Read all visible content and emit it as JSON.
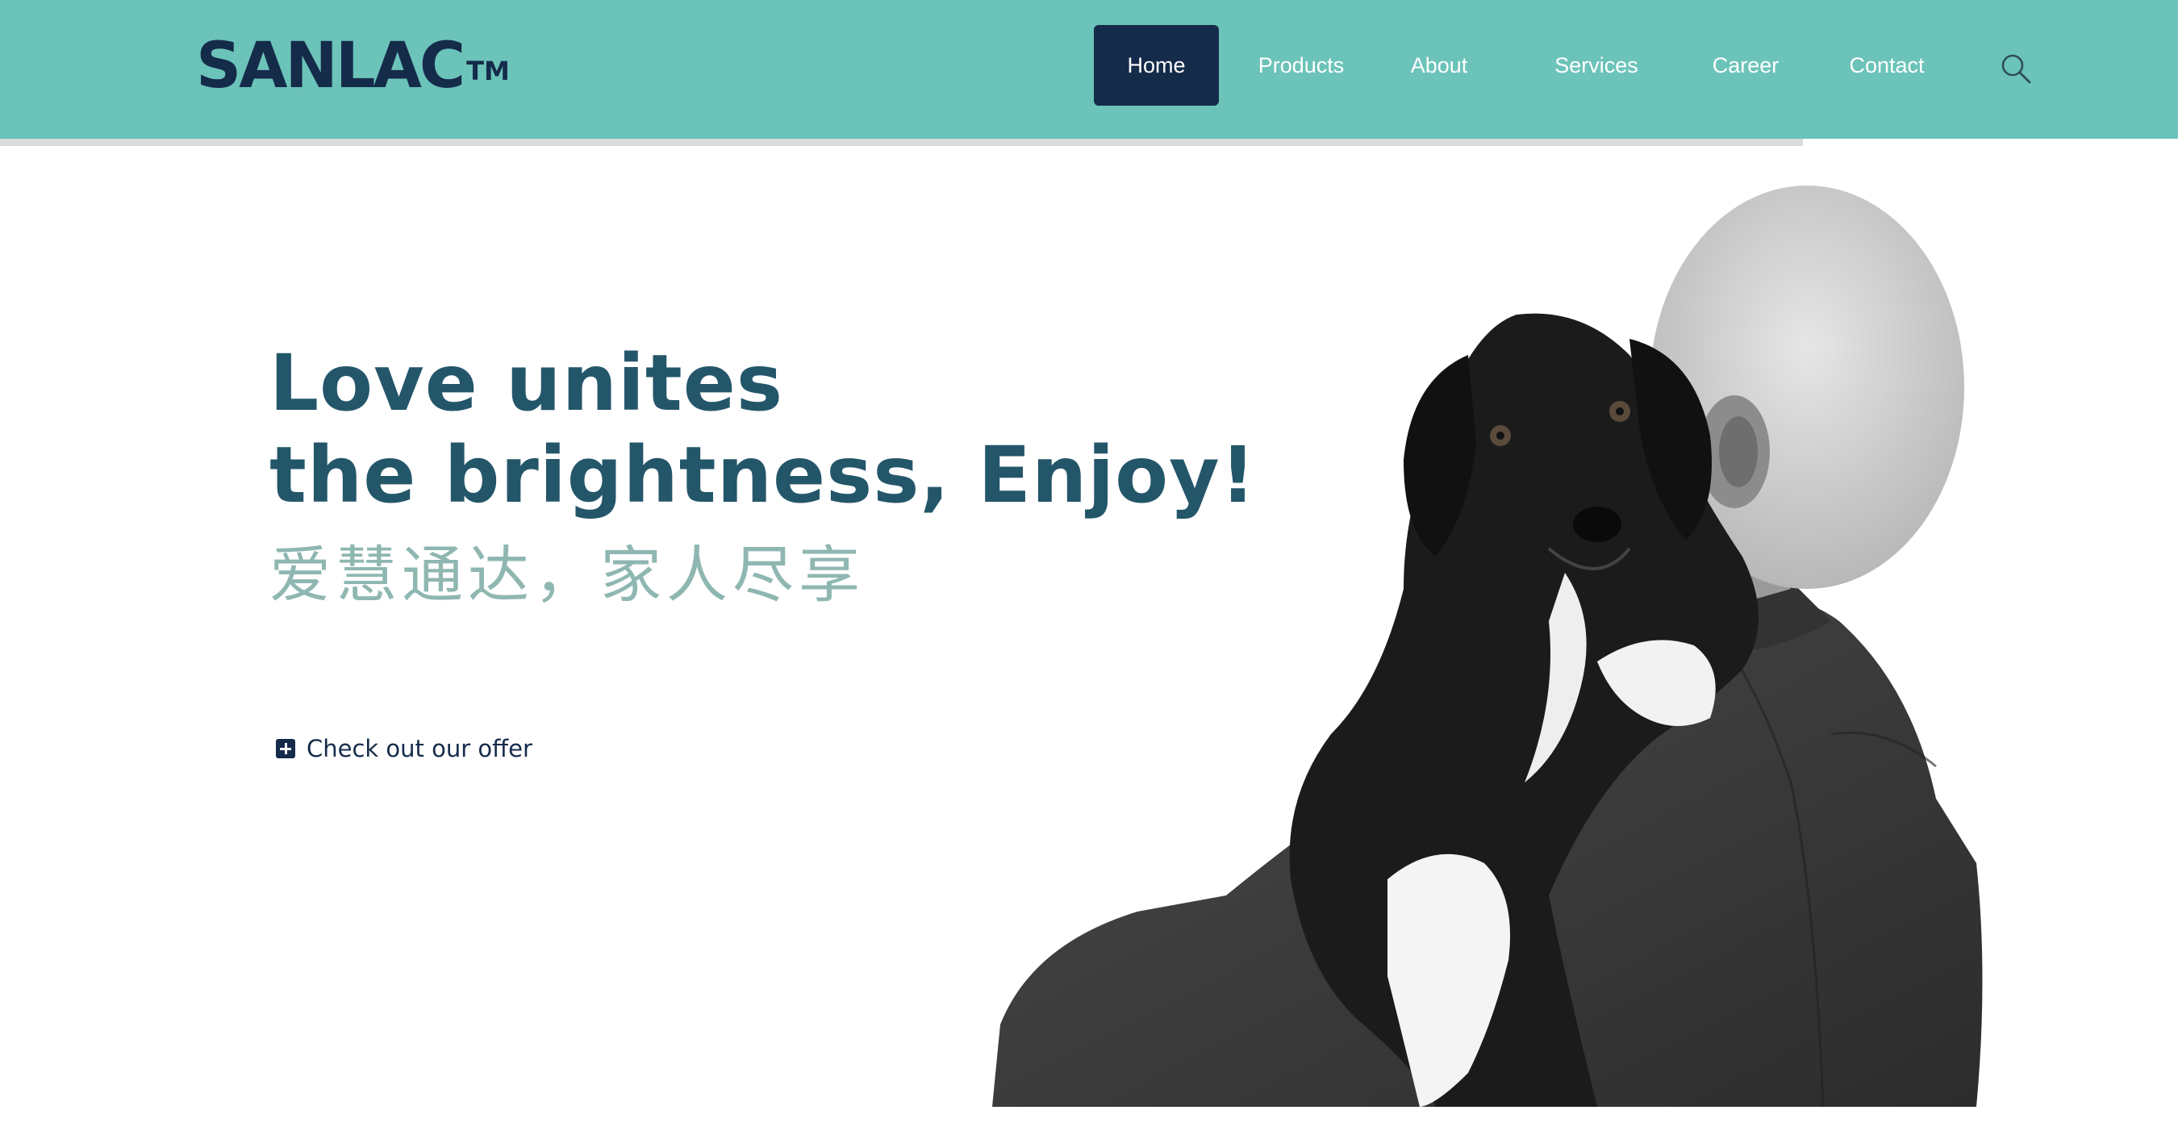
{
  "brand": {
    "name": "SANLAC",
    "trademark": "TM"
  },
  "nav": {
    "items": [
      {
        "label": "Home",
        "active": true
      },
      {
        "label": "Products",
        "active": false
      },
      {
        "label": "About",
        "active": false
      },
      {
        "label": "Services",
        "active": false
      },
      {
        "label": "Career",
        "active": false
      },
      {
        "label": "Contact",
        "active": false
      }
    ],
    "search_icon": "search-icon"
  },
  "hero": {
    "title_line1": "Love unites",
    "title_line2": "the brightness, Enjoy!",
    "subtitle_cn": "爱慧通达，家人尽享",
    "cta_label": "Check out our offer",
    "cta_icon": "plus-square-icon",
    "image": "elderly-man-holding-black-and-white-dog"
  },
  "colors": {
    "header_bg": "#6cc3b9",
    "nav_active_bg": "#152b4a",
    "brand_text": "#152b4a",
    "title_text": "#24566a",
    "subtitle_text": "#8fb7b1"
  }
}
